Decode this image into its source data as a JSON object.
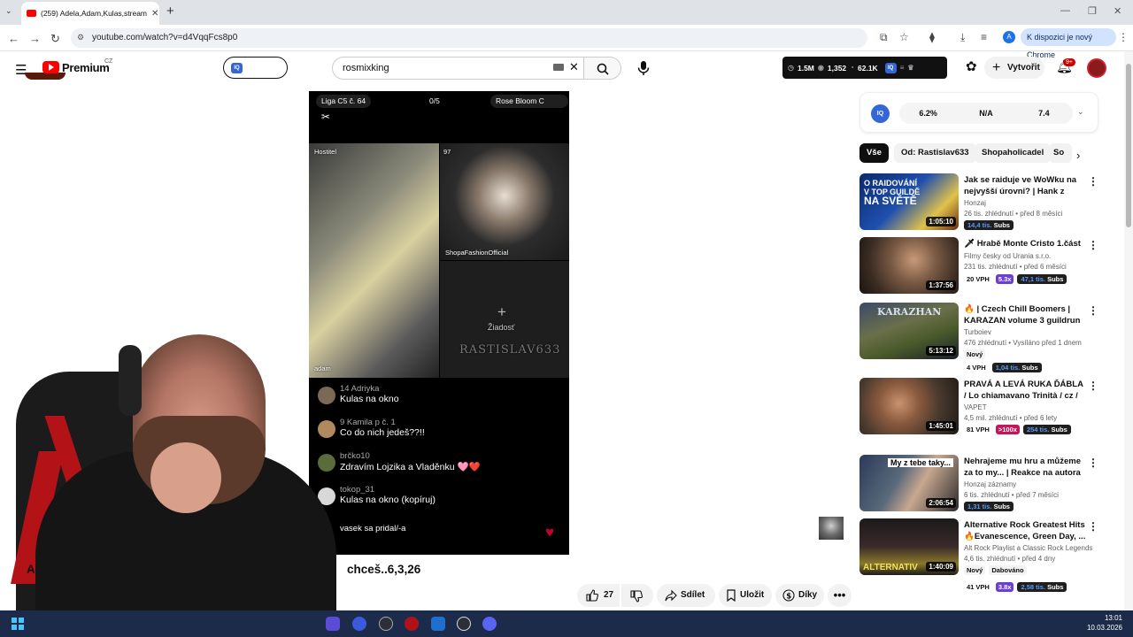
{
  "browser": {
    "tab_title": "(259) Adela,Adam,Kulas,stream",
    "url": "youtube.com/watch?v=d4VqqFcs8p0",
    "profile_letter": "A",
    "update_label": "K dispozici je nový Chrome"
  },
  "header": {
    "premium_label": "Premium",
    "region": "CZ",
    "iq_label": "IQ",
    "search_value": "rosmixking",
    "stats": {
      "views": "1.5M",
      "watching": "1,352",
      "likes": "62.1K"
    },
    "create_label": "Vytvořit",
    "notifications": "9+"
  },
  "player": {
    "top_left": "Liga C5 č. 64",
    "top_mid": "0/5",
    "top_right": "Rose Bloom C",
    "host_label": "Hostitel",
    "viewer_count": "97",
    "tile2_name": "ShopaFashionOfficial",
    "request_label": "Žiadosť",
    "watermark": "RASTISLAV633",
    "left_name": "adam",
    "chat": [
      {
        "name": "14 Adriyka",
        "text": "Kulas na okno"
      },
      {
        "name": "9 Kamila p  č. 1",
        "text": "Co do nich jedeš??!!"
      },
      {
        "name": "brčko10",
        "text": "Zdravím Lojzika a Vladěnku 🩷❤️"
      },
      {
        "name": "tokop_31",
        "text": "Kulas na okno (kopíruj)"
      },
      {
        "name": "",
        "text": "vasek sa pridal/-a"
      }
    ]
  },
  "video": {
    "title_start": "A",
    "title_tail": "chceš..6,3,26",
    "likes": "27",
    "share_label": "Sdílet",
    "save_label": "Uložit",
    "thanks_label": "Díky"
  },
  "iq_panel": {
    "m1": "6.2%",
    "m2": "N/A",
    "m3": "7.4"
  },
  "chips": [
    "Vše",
    "Od: Rastislav633",
    "Shopaholicadel",
    "So"
  ],
  "recs": [
    {
      "title": "Jak se raiduje ve WoWku na nejvyšší úrovni? | Hank z guild...",
      "channel": "Honzaj",
      "meta": "26 tis. zhlédnutí • před 8 měsíci",
      "duration": "1:05:10",
      "vph": "",
      "mult": "",
      "subs": "14,4 tis.",
      "new": ""
    },
    {
      "title": "🗡 Hrabě Monte Cristo 1.část",
      "channel": "Filmy česky od Urania s.r.o.",
      "meta": "231 tis. zhlédnutí • před 6 měsíci",
      "duration": "1:37:56",
      "vph": "20 VPH",
      "mult": "5.3x",
      "subs": "47,1 tis.",
      "new": ""
    },
    {
      "title": "🔥 | Czech Chill Boomers | KARAZAN volume 3 guildrun ...",
      "channel": "Turboiev",
      "meta": "476 zhlédnutí • Vysíláno před 1 dnem",
      "duration": "5:13:12",
      "vph": "4 VPH",
      "mult": "",
      "subs": "1,04 tis.",
      "new": "Nový"
    },
    {
      "title": "PRAVÁ A LEVÁ RUKA ĎÁBLA / Lo chiamavano Trinità / cz / ...",
      "channel": "VAPET",
      "meta": "4,5 mil. zhlédnutí • před 6 lety",
      "duration": "1:45:01",
      "vph": "81 VPH",
      "mult": ">100x",
      "subs": "254 tis.",
      "new": ""
    },
    {
      "title": "Nehrajeme mu hru a můžeme za to my... | Reakce na autora ...",
      "channel": "Honzaj záznamy",
      "meta": "6 tis. zhlédnutí • před 7 měsíci",
      "duration": "2:06:54",
      "vph": "",
      "mult": "",
      "subs": "1,31 tis.",
      "new": ""
    },
    {
      "title": "Alternative Rock Greatest Hits 🔥Evanescence, Green Day, ...",
      "channel": "Alt Rock Playlist a Classic Rock Legends",
      "meta": "4,6 tis. zhlédnutí • před 4 dny",
      "duration": "1:40:09",
      "vph": "41 VPH",
      "mult": "3.8x",
      "subs": "2,58 tis.",
      "new": "Nový",
      "extra": "Dabováno"
    }
  ],
  "subs_word": "Subs",
  "taskbar": {
    "time": "13:01",
    "date": "10.03.2026"
  }
}
